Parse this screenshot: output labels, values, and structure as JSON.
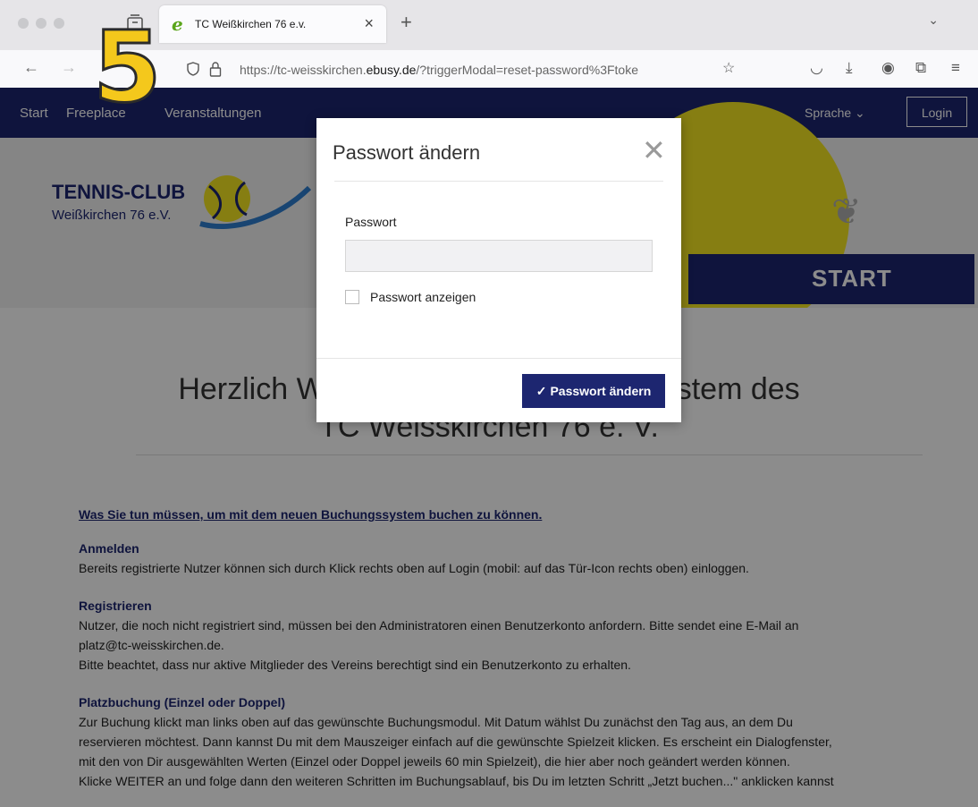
{
  "browser": {
    "tab_title": "TC Weißkirchen 76 e.v.",
    "url_prefix": "https://tc-weisskirchen.",
    "url_domain": "ebusy.de",
    "url_suffix": "/?triggerModal=reset-password%3Ftoke"
  },
  "step_badge": "5",
  "site_nav": {
    "items": [
      "Start",
      "Freeplace",
      "Veranstaltungen"
    ],
    "language": "Sprache",
    "login": "Login"
  },
  "hero": {
    "logo_line1": "TENNIS-CLUB",
    "logo_line2": "Weißkirchen 76 e.V.",
    "banner": "START"
  },
  "content": {
    "welcome_line1": "Herzlich Willkommen im Buchungssystem des",
    "welcome_line2": "TC Weisskirchen 76 e. V.",
    "lead": "Was Sie tun müssen, um mit dem neuen Buchungssystem buchen zu können.",
    "sections": [
      {
        "heading": "Anmelden",
        "lines": [
          "Bereits registrierte Nutzer können sich durch Klick rechts oben auf Login (mobil: auf das Tür-Icon rechts oben) einloggen."
        ]
      },
      {
        "heading": "Registrieren",
        "lines": [
          "Nutzer, die noch nicht registriert sind, müssen bei den Administratoren einen Benutzerkonto anfordern. Bitte sendet eine E-Mail an",
          "platz@tc-weisskirchen.de.",
          "Bitte beachtet, dass nur aktive Mitglieder des Vereins berechtigt sind ein Benutzerkonto zu erhalten."
        ]
      },
      {
        "heading": "Platzbuchung (Einzel oder Doppel)",
        "lines": [
          "Zur Buchung klickt man links oben auf das gewünschte Buchungsmodul. Mit Datum wählst Du zunächst den Tag aus, an dem Du",
          "reservieren möchtest. Dann kannst Du mit dem Mauszeiger einfach auf die gewünschte Spielzeit klicken. Es erscheint ein Dialogfenster,",
          "mit den von Dir ausgewählten Werten (Einzel oder Doppel jeweils 60 min Spielzeit), die hier aber noch geändert werden können.",
          "Klicke WEITER an und folge dann den weiteren  Schritten im Buchungsablauf, bis Du im letzten Schritt „Jetzt buchen...\" anklicken kannst"
        ]
      }
    ]
  },
  "modal": {
    "title": "Passwort ändern",
    "password_label": "Passwort",
    "password_value": "",
    "show_password_label": "Passwort anzeigen",
    "submit_label": "Passwort ändern"
  }
}
